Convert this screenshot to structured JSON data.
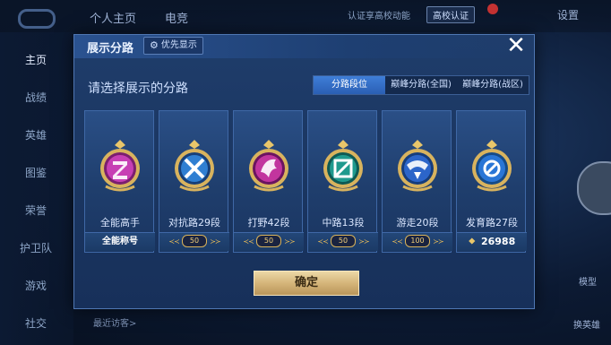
{
  "background": {
    "tabs": [
      "个人主页",
      "电竞"
    ],
    "cert_text": "认证享高校动能",
    "campus_badge": "高校认证",
    "settings": "设置",
    "sidebar": [
      "主页",
      "战绩",
      "英雄",
      "图鉴",
      "荣誉",
      "护卫队",
      "游戏",
      "社交"
    ],
    "right_labels": [
      "模型",
      "换英雄"
    ],
    "recent_visit": "最近访客>"
  },
  "modal": {
    "title": "展示分路",
    "priority_label": "优先显示",
    "close_label": "✕",
    "prompt": "请选择展示的分路",
    "tabs": [
      {
        "label": "分路段位",
        "active": true
      },
      {
        "label": "巅峰分路(全国)",
        "active": false
      },
      {
        "label": "巅峰分路(战区)",
        "active": false
      }
    ],
    "cards": [
      {
        "label": "全能高手",
        "footer_type": "title",
        "footer_text": "全能称号",
        "emblem": "all-round-emblem-icon",
        "color": "#c73fb4"
      },
      {
        "label": "对抗路29段",
        "footer_type": "badge",
        "footer_text": "50",
        "emblem": "clash-lane-emblem-icon",
        "color": "#2f7fd2"
      },
      {
        "label": "打野42段",
        "footer_type": "badge",
        "footer_text": "50",
        "emblem": "jungle-emblem-icon",
        "color": "#c2359e"
      },
      {
        "label": "中路13段",
        "footer_type": "badge",
        "footer_text": "50",
        "emblem": "mid-lane-emblem-icon",
        "color": "#1f9a8e"
      },
      {
        "label": "游走20段",
        "footer_type": "badge",
        "footer_text": "100",
        "emblem": "roam-emblem-icon",
        "color": "#2c65c9"
      },
      {
        "label": "发育路27段",
        "footer_type": "points",
        "footer_text": "26988",
        "emblem": "farm-lane-emblem-icon",
        "color": "#2a76d6"
      }
    ],
    "confirm_label": "确定"
  }
}
